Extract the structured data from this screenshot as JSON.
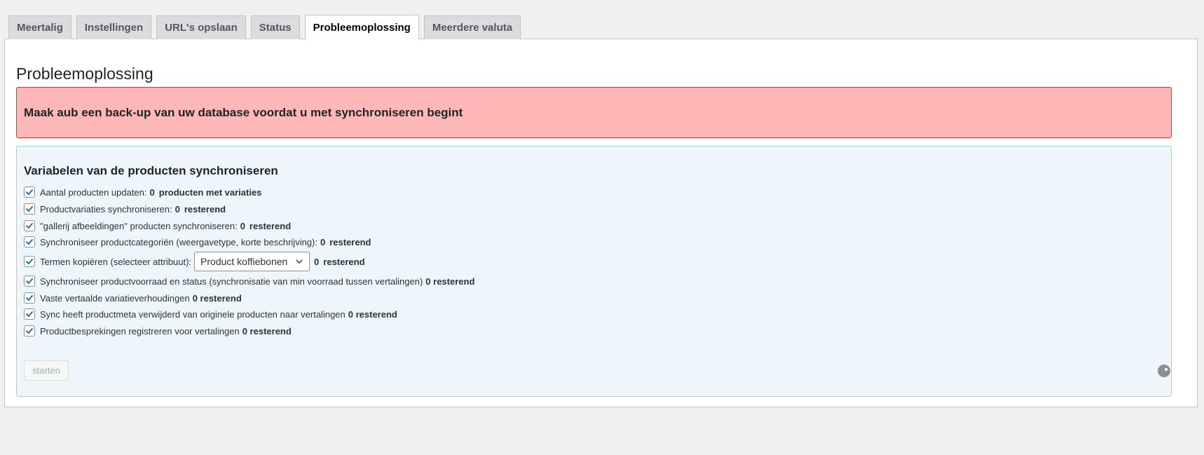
{
  "tabs": [
    {
      "label": "Meertalig",
      "active": false
    },
    {
      "label": "Instellingen",
      "active": false
    },
    {
      "label": "URL's opslaan",
      "active": false
    },
    {
      "label": "Status",
      "active": false
    },
    {
      "label": "Probleemoplossing",
      "active": true
    },
    {
      "label": "Meerdere valuta",
      "active": false
    }
  ],
  "page": {
    "title": "Probleemoplossing",
    "warning": "Maak aub een back-up van uw database voordat u met synchroniseren begint"
  },
  "sync": {
    "title": "Variabelen van de producten synchroniseren",
    "rows": [
      {
        "label": "Aantal producten updaten:",
        "count": "0",
        "suffix": "producten met variaties",
        "checked": true
      },
      {
        "label": "Productvariaties synchroniseren:",
        "count": "0",
        "suffix": "resterend",
        "checked": true
      },
      {
        "label": "\"gallerij afbeeldingen\" producten synchroniseren:",
        "count": "0",
        "suffix": "resterend",
        "checked": true
      },
      {
        "label": "Synchroniseer productcategoriën (weergavetype, korte beschrijving):",
        "count": "0",
        "suffix": "resterend",
        "checked": true
      },
      {
        "label": "Termen kopiëren (selecteer attribuut):",
        "select_value": "Product koffiebonen",
        "count": "0",
        "suffix": "resterend",
        "checked": true
      },
      {
        "label": "Synchroniseer productvoorraad en status (synchronisatie van min voorraad tussen vertalingen)",
        "count": "0 resterend",
        "checked": true
      },
      {
        "label": "Vaste vertaalde variatieverhoudingen",
        "count": "0 resterend",
        "checked": true
      },
      {
        "label": "Sync heeft productmeta verwijderd van originele producten naar vertalingen",
        "count": "0 resterend",
        "checked": true
      },
      {
        "label": "Productbesprekingen registreren voor vertalingen",
        "count": "0 resterend",
        "checked": true
      }
    ],
    "start_label": "starten"
  },
  "colors": {
    "accent": "#2271b1",
    "warning_bg": "#ffb7b7",
    "warning_border": "#d63638",
    "info_bg": "#eef6fc",
    "info_border": "#9fd1dd"
  },
  "icons": {
    "checkbox": "checkmark-icon",
    "select": "chevron-down-icon",
    "loading": "spinner-icon"
  }
}
